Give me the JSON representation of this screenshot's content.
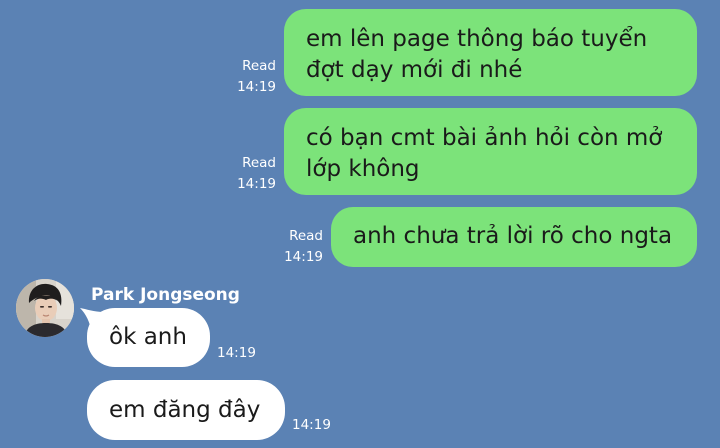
{
  "chat": {
    "outgoing": [
      {
        "lines": [
          "em lên page thông báo tuyển",
          "đợt dạy mới đi nhé"
        ],
        "status": "Read",
        "time": "14:19"
      },
      {
        "lines": [
          "có bạn cmt bài ảnh hỏi còn mở",
          "lớp không"
        ],
        "status": "Read",
        "time": "14:19"
      },
      {
        "lines": [
          "anh chưa trả lời rõ cho ngta"
        ],
        "status": "Read",
        "time": "14:19"
      }
    ],
    "contact": {
      "name": "Park Jongseong"
    },
    "incoming": [
      {
        "text": "ôk anh",
        "time": "14:19"
      },
      {
        "text": "em đăng đây",
        "time": "14:19"
      }
    ]
  },
  "colors": {
    "background": "#5b82b4",
    "outgoing_bubble": "#7ce37a",
    "incoming_bubble": "#ffffff",
    "meta_text": "#ffffff"
  },
  "icons": {
    "avatar": "contact-avatar-photo"
  }
}
